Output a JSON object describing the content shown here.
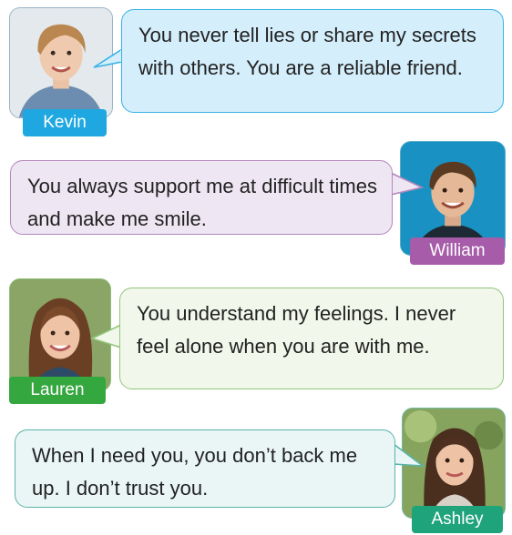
{
  "cards": [
    {
      "id": "kevin",
      "name": "Kevin",
      "text": "You never tell lies or share my secrets with others. You are a reliable friend.",
      "tag_color": "#1ea7e0",
      "bubble_bg": "#d4eefb",
      "bubble_border": "#39b2e6"
    },
    {
      "id": "william",
      "name": "William",
      "text": "You always support me at difficult times and make me smile.",
      "tag_color": "#a65ca8",
      "bubble_bg": "#eee6f2",
      "bubble_border": "#b586bb"
    },
    {
      "id": "lauren",
      "name": "Lauren",
      "text": "You understand my feelings. I never feel alone when you are with me.",
      "tag_color": "#35a73f",
      "bubble_bg": "#f1f7ea",
      "bubble_border": "#92c67c"
    },
    {
      "id": "ashley",
      "name": "Ashley",
      "text": "When I need you, you don’t back me up. I don’t trust you.",
      "tag_color": "#1fa37a",
      "bubble_bg": "#eaf6f6",
      "bubble_border": "#58b4a8"
    }
  ]
}
